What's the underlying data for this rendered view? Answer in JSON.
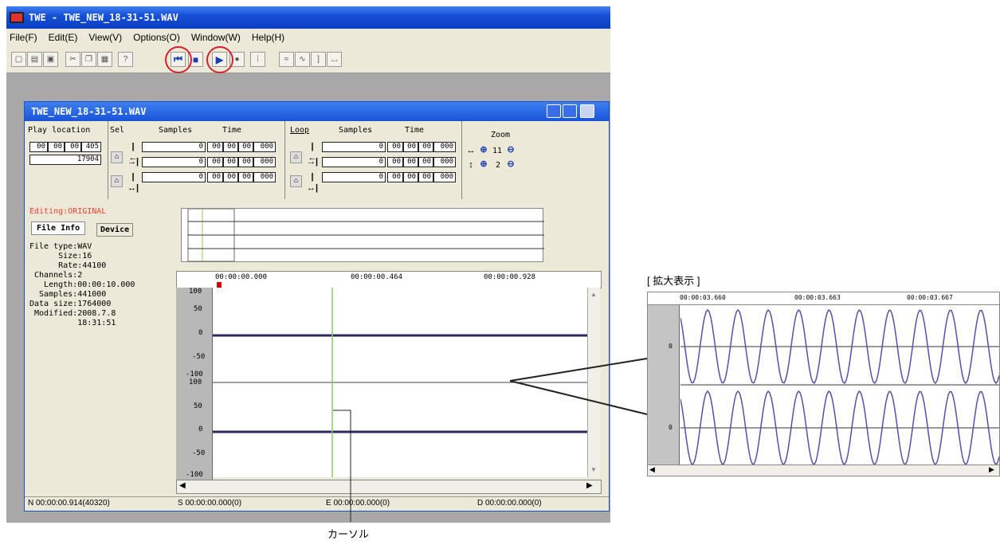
{
  "app": {
    "title": "TWE - TWE_NEW_18-31-51.WAV"
  },
  "menu": [
    "File(F)",
    "Edit(E)",
    "View(V)",
    "Options(O)",
    "Window(W)",
    "Help(H)"
  ],
  "child": {
    "title": "TWE_NEW_18-31-51.WAV"
  },
  "play": {
    "label": "Play location",
    "time": [
      "00",
      "00",
      "00",
      "405"
    ],
    "samples": "17904"
  },
  "sel": {
    "label": "Sel",
    "samples_label": "Samples",
    "time_label": "Time",
    "rows": [
      {
        "samples": "0",
        "time": [
          "00",
          "00",
          "00",
          "000"
        ]
      },
      {
        "samples": "0",
        "time": [
          "00",
          "00",
          "00",
          "000"
        ]
      },
      {
        "samples": "0",
        "time": [
          "00",
          "00",
          "00",
          "000"
        ]
      }
    ]
  },
  "loop": {
    "label": "Loop",
    "samples_label": "Samples",
    "time_label": "Time",
    "rows": [
      {
        "samples": "0",
        "time": [
          "00",
          "00",
          "00",
          "000"
        ]
      },
      {
        "samples": "0",
        "time": [
          "00",
          "00",
          "00",
          "000"
        ]
      },
      {
        "samples": "0",
        "time": [
          "00",
          "00",
          "00",
          "000"
        ]
      }
    ]
  },
  "zoom": {
    "label": "Zoom",
    "h": "11",
    "v": "2"
  },
  "left": {
    "editing": "Editing:ORIGINAL",
    "tabs": [
      "File Info",
      "Device"
    ],
    "info": [
      "File type:WAV",
      "      Size:16",
      "      Rate:44100",
      " Channels:2",
      "   Length:00:00:10.000",
      "  Samples:441000",
      "Data size:1764000",
      " Modified:2008.7.8",
      "          18:31:51"
    ]
  },
  "ruler": {
    "ticks": [
      "00:00:00.000",
      "00:00:00.464",
      "00:00:00.928"
    ]
  },
  "yaxis": [
    "100",
    "50",
    "0",
    "-50",
    "-100"
  ],
  "status": {
    "n": "N 00:00:00.914(40320)",
    "s": "S 00:00:00.000(0)",
    "e": "E 00:00:00.000(0)",
    "d": "D 00:00:00.000(0)"
  },
  "zoomview": {
    "caption": "[ 拡大表示 ]",
    "ticks": [
      "00:00:03.660",
      "00:00:03.663",
      "00:00:03.667"
    ],
    "zero": "0"
  },
  "annotation": {
    "cursor": "カーソル"
  },
  "colors": {
    "wave": "#5a4ea8",
    "cursor": "#8ccc60",
    "highlight": "#d8202c",
    "editing": "#e84030"
  }
}
